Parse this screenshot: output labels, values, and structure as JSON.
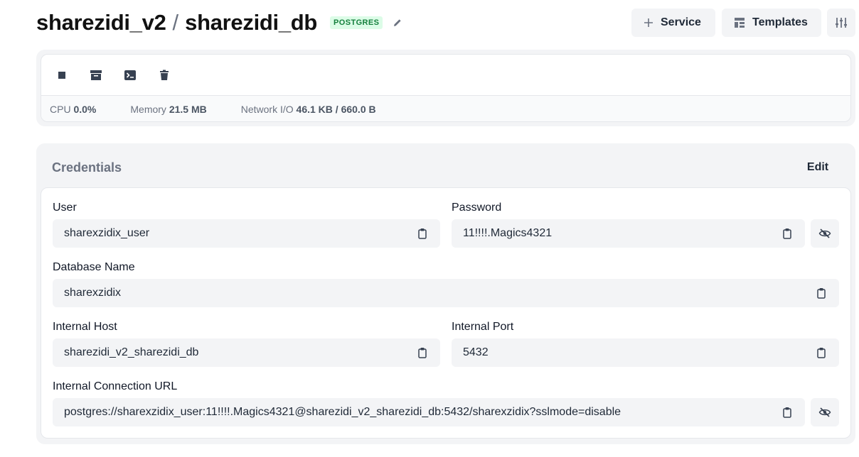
{
  "header": {
    "project": "sharezidi_v2",
    "separator": "/",
    "service": "sharezidi_db",
    "badge": "POSTGRES",
    "buttons": {
      "service": "Service",
      "templates": "Templates"
    }
  },
  "stats": {
    "cpu_label": "CPU",
    "cpu_value": "0.0%",
    "memory_label": "Memory",
    "memory_value": "21.5 MB",
    "network_label": "Network I/O",
    "network_value": "46.1 KB / 660.0 B"
  },
  "credentials": {
    "title": "Credentials",
    "edit_label": "Edit",
    "user_label": "User",
    "user_value": "sharexzidix_user",
    "password_label": "Password",
    "password_value": "11!!!!.Magics4321",
    "dbname_label": "Database Name",
    "dbname_value": "sharexzidix",
    "host_label": "Internal Host",
    "host_value": "sharezidi_v2_sharezidi_db",
    "port_label": "Internal Port",
    "port_value": "5432",
    "url_label": "Internal Connection URL",
    "url_value": "postgres://sharexzidix_user:11!!!!.Magics4321@sharezidi_v2_sharezidi_db:5432/sharexzidix?sslmode=disable"
  },
  "icons": {
    "action_icons": [
      "stop-icon",
      "archive-icon",
      "terminal-icon",
      "trash-icon"
    ],
    "copy": "clipboard-icon",
    "reveal": "eye-off-icon"
  },
  "colors": {
    "badge_bg": "#dcfce7",
    "badge_text": "#15803d",
    "panel_bg": "#f3f4f6"
  }
}
